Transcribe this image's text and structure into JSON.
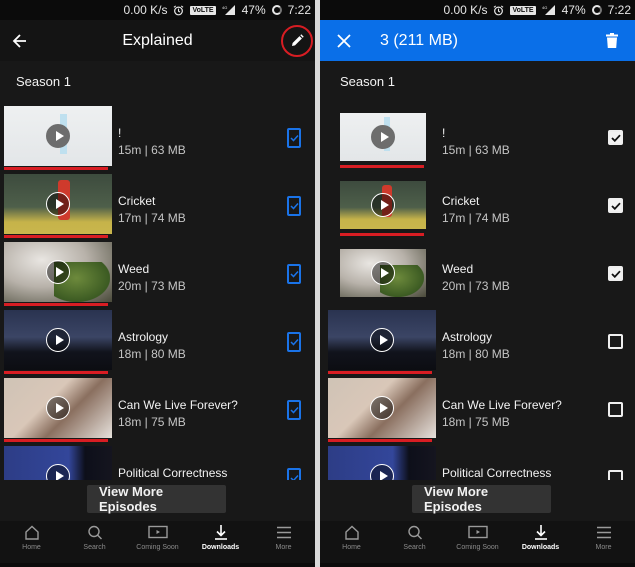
{
  "status_bar": {
    "net_speed": "0.00 K/s",
    "alarm_icon": "alarm-clock-icon",
    "volte_badge": "VoLTE",
    "network": "4G",
    "battery": "47%",
    "time": "7:22"
  },
  "left_screen": {
    "header": {
      "back_icon": "arrow-left-icon",
      "title": "Explained",
      "edit_icon": "pencil-icon",
      "highlight_color": "#d81d23"
    },
    "season_label": "Season 1",
    "episodes": [
      {
        "title": "!",
        "meta": "15m | 63 MB",
        "selected": true
      },
      {
        "title": "Cricket",
        "meta": "17m | 74 MB",
        "selected": true
      },
      {
        "title": "Weed",
        "meta": "20m | 73 MB",
        "selected": true
      },
      {
        "title": "Astrology",
        "meta": "18m | 80 MB",
        "selected": true
      },
      {
        "title": "Can We Live Forever?",
        "meta": "18m | 75 MB",
        "selected": true
      },
      {
        "title": "Political Correctness",
        "meta": "",
        "selected": true
      }
    ],
    "view_more_label": "View More Episodes"
  },
  "right_screen": {
    "header": {
      "close_icon": "close-icon",
      "selection_summary": "3 (211 MB)",
      "delete_icon": "trash-icon",
      "bar_color": "#0a6fe8"
    },
    "season_label": "Season 1",
    "episodes": [
      {
        "title": "!",
        "meta": "15m | 63 MB",
        "selected": true
      },
      {
        "title": "Cricket",
        "meta": "17m | 74 MB",
        "selected": true
      },
      {
        "title": "Weed",
        "meta": "20m | 73 MB",
        "selected": true
      },
      {
        "title": "Astrology",
        "meta": "18m | 80 MB",
        "selected": false
      },
      {
        "title": "Can We Live Forever?",
        "meta": "18m | 75 MB",
        "selected": false
      },
      {
        "title": "Political Correctness",
        "meta": "",
        "selected": false
      }
    ],
    "view_more_label": "View More Episodes"
  },
  "bottom_nav": [
    {
      "label": "Home",
      "icon": "home-icon",
      "active": false
    },
    {
      "label": "Search",
      "icon": "search-icon",
      "active": false
    },
    {
      "label": "Coming Soon",
      "icon": "coming-soon-icon",
      "active": false
    },
    {
      "label": "Downloads",
      "icon": "download-icon",
      "active": true
    },
    {
      "label": "More",
      "icon": "menu-icon",
      "active": false
    }
  ],
  "colors": {
    "background": "#181818",
    "progress_red": "#d81d23",
    "checkbox_blue": "#1a73e8"
  }
}
